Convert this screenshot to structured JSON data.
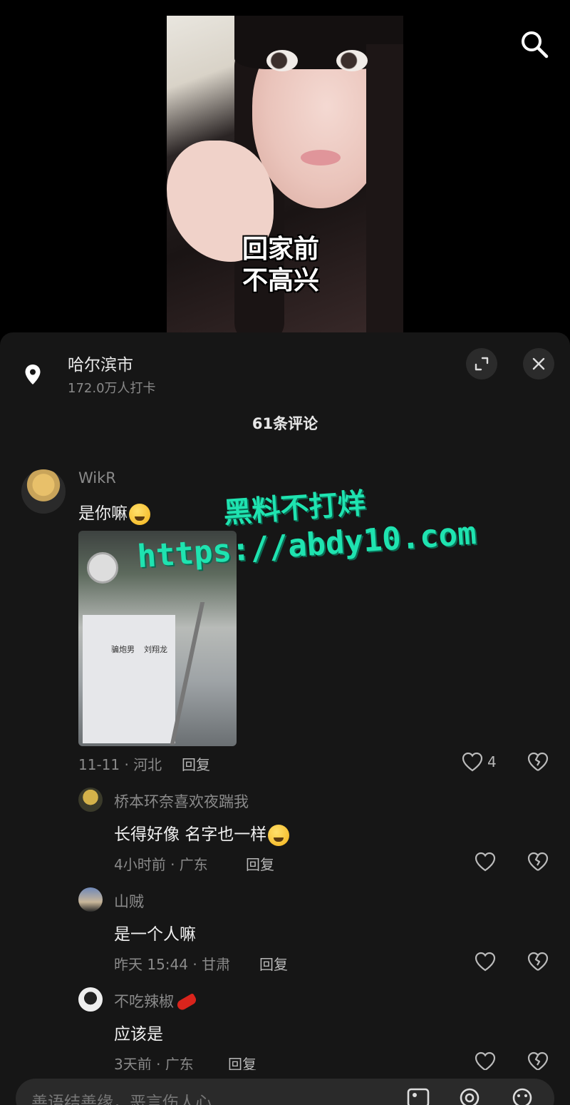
{
  "video": {
    "caption_line1": "回家前",
    "caption_line2": "不高兴"
  },
  "location": {
    "name": "哈尔滨市",
    "checkins": "172.0万人打卡"
  },
  "comment_count": "61条评论",
  "watermark": {
    "line1": "黑料不打烊",
    "line2": "https://abdy10.com"
  },
  "comments": [
    {
      "user": "WikR",
      "text": "是你嘛",
      "meta": "11-11 · 河北",
      "reply": "回复",
      "likes": "4",
      "has_image": true,
      "image_labels": [
        "骗炮男",
        "刘翔龙"
      ]
    }
  ],
  "replies": [
    {
      "user": "桥本环奈喜欢夜踹我",
      "text": "长得好像 名字也一样",
      "meta": "4小时前 · 广东",
      "reply": "回复"
    },
    {
      "user": "山贼",
      "text": "是一个人嘛",
      "meta": "昨天 15:44 · 甘肃",
      "reply": "回复"
    },
    {
      "user": "不吃辣椒",
      "text": "应该是",
      "meta": "3天前 · 广东",
      "reply": "回复"
    }
  ],
  "input": {
    "placeholder": "善语结善缘，恶言伤人心"
  },
  "colors": {
    "sheet_bg": "#161616",
    "watermark": "#1fe3b0",
    "muted_text": "#8a8a8a"
  }
}
